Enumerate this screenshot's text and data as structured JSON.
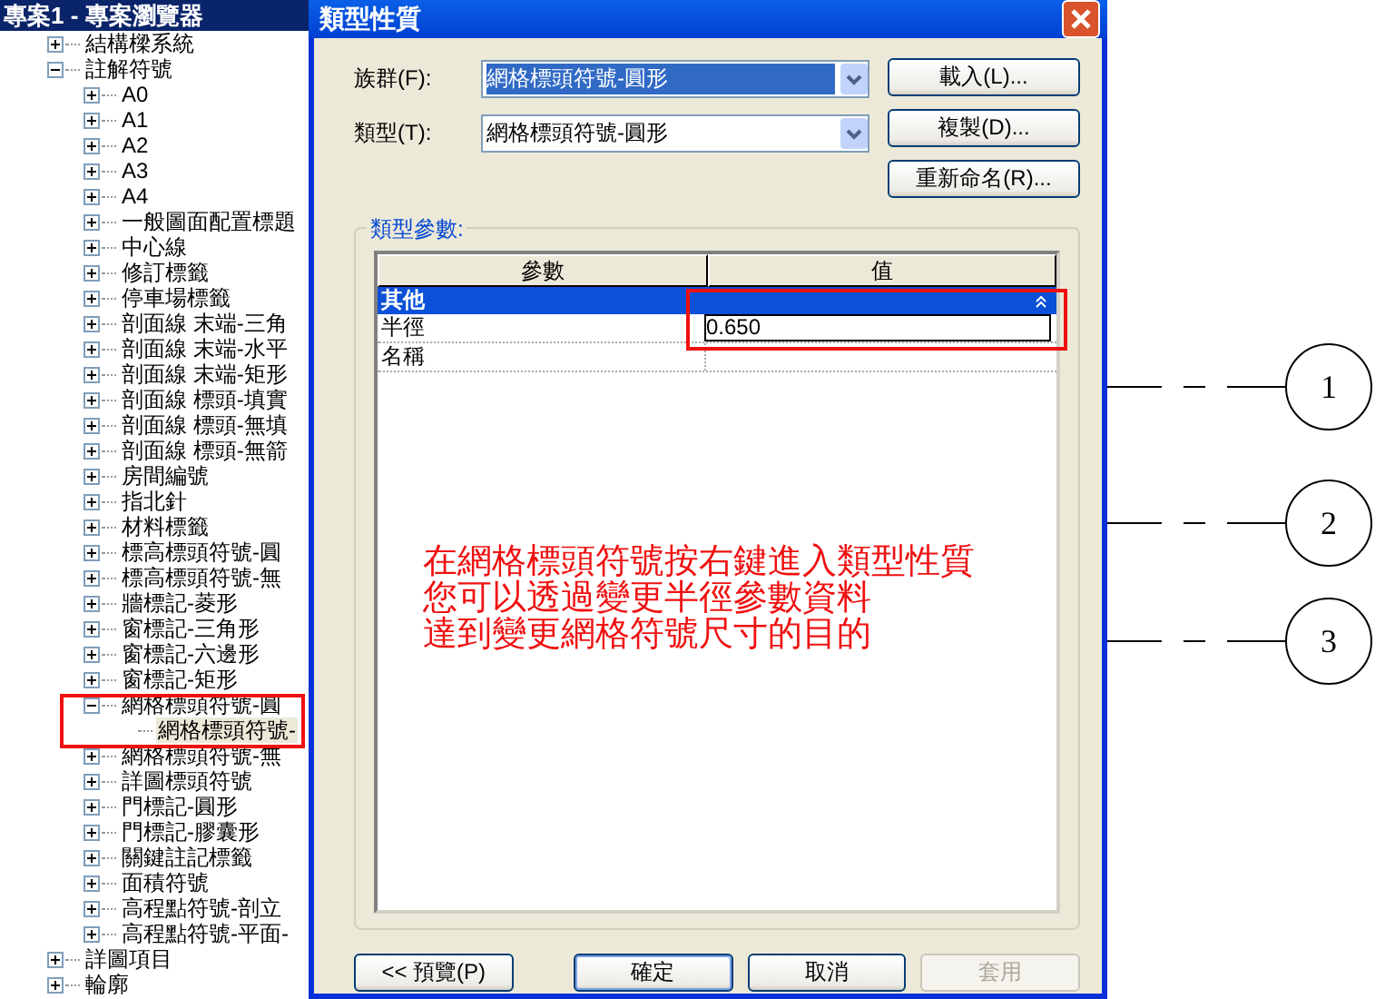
{
  "project_browser": {
    "title": "專案1 - 專案瀏覽器",
    "tree": [
      {
        "label": "結構樑系統",
        "expanded": false,
        "selected": false
      },
      {
        "label": "註解符號",
        "expanded": true,
        "selected": false,
        "children": [
          {
            "label": "A0",
            "expanded": false,
            "selected": false
          },
          {
            "label": "A1",
            "expanded": false,
            "selected": false
          },
          {
            "label": "A2",
            "expanded": false,
            "selected": false
          },
          {
            "label": "A3",
            "expanded": false,
            "selected": false
          },
          {
            "label": "A4",
            "expanded": false,
            "selected": false
          },
          {
            "label": "一般圖面配置標題",
            "expanded": false,
            "selected": false
          },
          {
            "label": "中心線",
            "expanded": false,
            "selected": false
          },
          {
            "label": "修訂標籤",
            "expanded": false,
            "selected": false
          },
          {
            "label": "停車場標籤",
            "expanded": false,
            "selected": false
          },
          {
            "label": "剖面線 末端-三角",
            "expanded": false,
            "selected": false
          },
          {
            "label": "剖面線 末端-水平",
            "expanded": false,
            "selected": false
          },
          {
            "label": "剖面線 末端-矩形",
            "expanded": false,
            "selected": false
          },
          {
            "label": "剖面線 標頭-填實",
            "expanded": false,
            "selected": false
          },
          {
            "label": "剖面線 標頭-無填",
            "expanded": false,
            "selected": false
          },
          {
            "label": "剖面線 標頭-無箭",
            "expanded": false,
            "selected": false
          },
          {
            "label": "房間編號",
            "expanded": false,
            "selected": false
          },
          {
            "label": "指北針",
            "expanded": false,
            "selected": false
          },
          {
            "label": "材料標籤",
            "expanded": false,
            "selected": false
          },
          {
            "label": "標高標頭符號-圓",
            "expanded": false,
            "selected": false
          },
          {
            "label": "標高標頭符號-無",
            "expanded": false,
            "selected": false
          },
          {
            "label": "牆標記-菱形",
            "expanded": false,
            "selected": false
          },
          {
            "label": "窗標記-三角形",
            "expanded": false,
            "selected": false
          },
          {
            "label": "窗標記-六邊形",
            "expanded": false,
            "selected": false
          },
          {
            "label": "窗標記-矩形",
            "expanded": false,
            "selected": false
          },
          {
            "label": "網格標頭符號-圓",
            "expanded": true,
            "selected": false,
            "children": [
              {
                "label": "網格標頭符號-",
                "selected": true
              }
            ]
          },
          {
            "label": "網格標頭符號-無",
            "expanded": false,
            "selected": false
          },
          {
            "label": "詳圖標頭符號",
            "expanded": false,
            "selected": false
          },
          {
            "label": "門標記-圓形",
            "expanded": false,
            "selected": false
          },
          {
            "label": "門標記-膠囊形",
            "expanded": false,
            "selected": false
          },
          {
            "label": "關鍵註記標籤",
            "expanded": false,
            "selected": false
          },
          {
            "label": "面積符號",
            "expanded": false,
            "selected": false
          },
          {
            "label": "高程點符號-剖立",
            "expanded": false,
            "selected": false
          },
          {
            "label": "高程點符號-平面-",
            "expanded": false,
            "selected": false
          }
        ]
      },
      {
        "label": "詳圖項目",
        "expanded": false,
        "selected": false
      },
      {
        "label": "輪廓",
        "expanded": false,
        "selected": false
      }
    ]
  },
  "dialog": {
    "title": "類型性質",
    "fields": [
      {
        "label": "族群(F):",
        "value": "網格標頭符號-圓形",
        "selected": true
      },
      {
        "label": "類型(T):",
        "value": "網格標頭符號-圓形",
        "selected": false
      }
    ],
    "side_buttons": [
      "載入(L)...",
      "複製(D)...",
      "重新命名(R)..."
    ],
    "group_label": "類型參數:",
    "table": {
      "columns": [
        "參數",
        "值"
      ],
      "groups": [
        {
          "name": "其他",
          "expanded": true,
          "rows": [
            {
              "name": "半徑",
              "value": "0.650",
              "editing": true
            },
            {
              "name": "名稱",
              "editing": false
            }
          ]
        }
      ]
    },
    "note_lines": [
      "在網格標頭符號按右鍵進入類型性質",
      "您可以透過變更半徑參數資料",
      "達到變更網格符號尺寸的目的"
    ],
    "buttons": [
      {
        "label": "<< 預覽(P)",
        "disabled": false,
        "default": false
      },
      {
        "label": "確定",
        "disabled": false,
        "default": true
      },
      {
        "label": "取消",
        "disabled": false,
        "default": false
      },
      {
        "label": "套用",
        "disabled": true,
        "default": false
      }
    ]
  },
  "grid_bubbles": [
    {
      "label": "1"
    },
    {
      "label": "2"
    },
    {
      "label": "3"
    }
  ]
}
